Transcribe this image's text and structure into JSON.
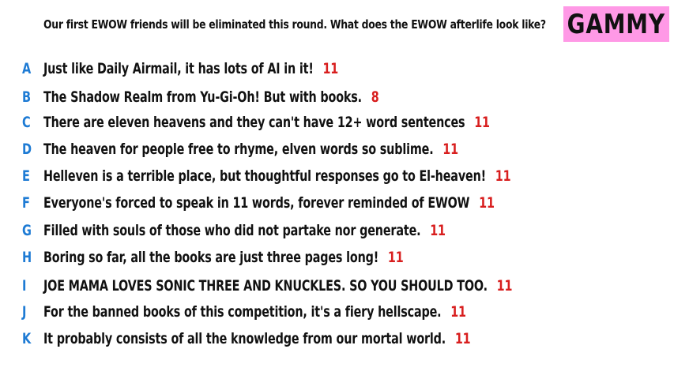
{
  "prompt": "Our first EWOW friends will be eliminated this round. What does the EWOW afterlife look like?",
  "name_badge": "GAMMY",
  "colors": {
    "letter": "#1e7bd4",
    "count": "#d81e1e",
    "badge_bg": "#ff99e6"
  },
  "responses": [
    {
      "letter": "A",
      "text": "Just like Daily Airmail, it has lots of AI in it!",
      "count": "11"
    },
    {
      "letter": "B",
      "text": "The Shadow Realm from Yu-Gi-Oh! But with books.",
      "count": "8"
    },
    {
      "letter": "C",
      "text": "There are eleven heavens and they can't have 12+ word sentences",
      "count": "11"
    },
    {
      "letter": "D",
      "text": "The heaven for people free to rhyme, elven words so sublime.",
      "count": "11"
    },
    {
      "letter": "E",
      "text": "Helleven is a terrible place, but thoughtful responses go to El-heaven!",
      "count": "11"
    },
    {
      "letter": "F",
      "text": "Everyone's forced to speak in 11 words, forever reminded of EWOW",
      "count": "11"
    },
    {
      "letter": "G",
      "text": "Filled with souls of those who did not partake nor generate.",
      "count": "11"
    },
    {
      "letter": "H",
      "text": "Boring so far, all the books are just three pages long!",
      "count": "11"
    },
    {
      "letter": "I",
      "text": "JOE MAMA LOVES SONIC THREE AND KNUCKLES. SO YOU SHOULD TOO.",
      "count": "11"
    },
    {
      "letter": "J",
      "text": "For the banned books of this competition, it's a fiery hellscape.",
      "count": "11"
    },
    {
      "letter": "K",
      "text": "It probably consists of all the knowledge from our mortal world.",
      "count": "11"
    }
  ]
}
